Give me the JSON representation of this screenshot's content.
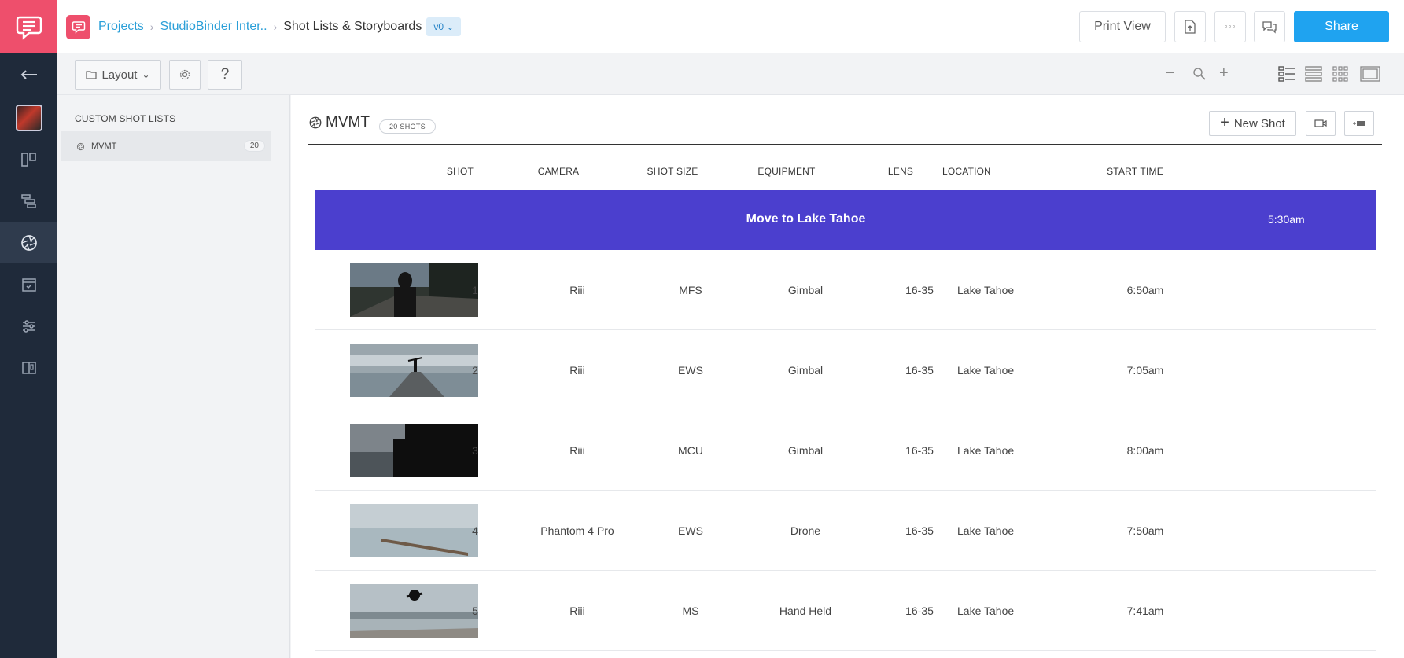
{
  "breadcrumb": {
    "items": [
      "Projects",
      "StudioBinder Inter..",
      "Shot Lists & Storyboards"
    ],
    "version": "v0"
  },
  "header": {
    "print_view": "Print View",
    "share": "Share"
  },
  "toolbar": {
    "layout_label": "Layout",
    "help_label": "?"
  },
  "sidebar": {
    "title": "CUSTOM SHOT LISTS",
    "lists": [
      {
        "name": "MVMT",
        "count": "20"
      }
    ]
  },
  "main": {
    "title": "MVMT",
    "shots_badge": "20 SHOTS",
    "new_shot": "New Shot",
    "columns": {
      "shot": "SHOT",
      "camera": "CAMERA",
      "shot_size": "SHOT SIZE",
      "equipment": "EQUIPMENT",
      "lens": "LENS",
      "location": "LOCATION",
      "start_time": "START TIME"
    },
    "banner": {
      "title": "Move to Lake Tahoe",
      "time": "5:30am"
    },
    "rows": [
      {
        "shot": "1",
        "camera": "Riii",
        "shot_size": "MFS",
        "equipment": "Gimbal",
        "lens": "16-35",
        "location": "Lake Tahoe",
        "start_time": "6:50am"
      },
      {
        "shot": "2",
        "camera": "Riii",
        "shot_size": "EWS",
        "equipment": "Gimbal",
        "lens": "16-35",
        "location": "Lake Tahoe",
        "start_time": "7:05am"
      },
      {
        "shot": "3",
        "camera": "Riii",
        "shot_size": "MCU",
        "equipment": "Gimbal",
        "lens": "16-35",
        "location": "Lake Tahoe",
        "start_time": "8:00am"
      },
      {
        "shot": "4",
        "camera": "Phantom 4 Pro",
        "shot_size": "EWS",
        "equipment": "Drone",
        "lens": "16-35",
        "location": "Lake Tahoe",
        "start_time": "7:50am"
      },
      {
        "shot": "5",
        "camera": "Riii",
        "shot_size": "MS",
        "equipment": "Hand Held",
        "lens": "16-35",
        "location": "Lake Tahoe",
        "start_time": "7:41am"
      }
    ]
  },
  "colors": {
    "brand": "#ee4f6c",
    "accent": "#1fa3f0",
    "banner": "#4b3fce",
    "rail": "#1f2a3a"
  },
  "icons": [
    "studiobinder-logo",
    "back-arrow-icon",
    "project-thumbnail",
    "board-icon",
    "gantt-icon",
    "shutter-icon",
    "calendar-icon",
    "sliders-icon",
    "book-icon",
    "export-icon",
    "more-icon",
    "comments-icon",
    "gear-icon",
    "zoom-out-icon",
    "zoom-icon",
    "zoom-in-icon",
    "list-view-icon",
    "rows-view-icon",
    "grid-view-icon",
    "film-view-icon",
    "camera-icon",
    "insert-row-icon"
  ]
}
